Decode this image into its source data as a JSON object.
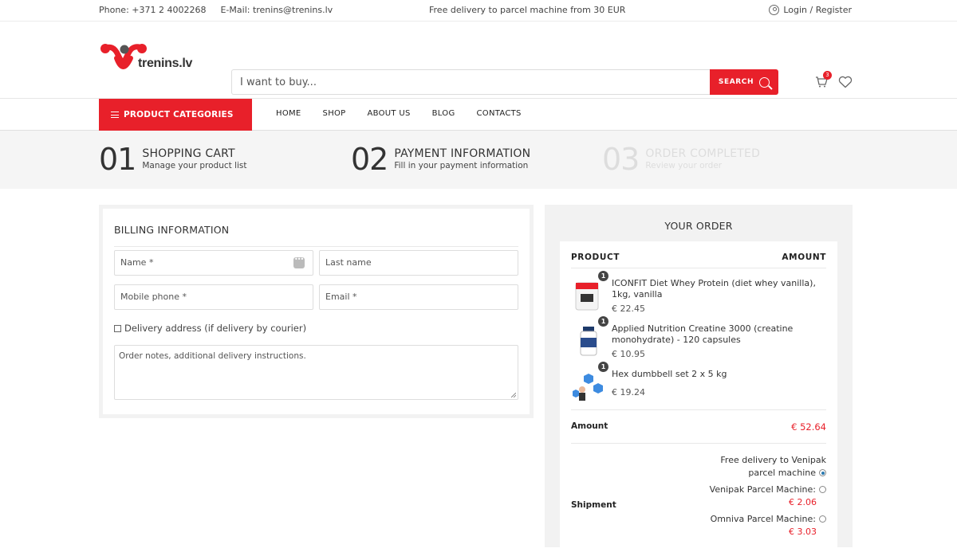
{
  "topbar": {
    "phone": "Phone: +371 2 4002268",
    "email": "E-Mail: trenins@trenins.lv",
    "promo": "Free delivery to parcel machine from 30 EUR",
    "login": "Login / Register"
  },
  "header": {
    "logo_text": "trenins.lv",
    "search_placeholder": "I want to buy...",
    "search_button": "SEARCH",
    "cart_count": "3"
  },
  "nav": {
    "categories_button": "PRODUCT CATEGORIES",
    "links": [
      "HOME",
      "SHOP",
      "ABOUT US",
      "BLOG",
      "CONTACTS"
    ]
  },
  "steps": [
    {
      "num": "01",
      "title": "SHOPPING CART",
      "subtitle": "Manage your product list"
    },
    {
      "num": "02",
      "title": "PAYMENT INFORMATION",
      "subtitle": "Fill in your payment information"
    },
    {
      "num": "03",
      "title": "ORDER COMPLETED",
      "subtitle": "Review your order"
    }
  ],
  "billing": {
    "title": "BILLING INFORMATION",
    "name_placeholder": "Name *",
    "lastname_placeholder": "Last name",
    "phone_placeholder": "Mobile phone *",
    "email_placeholder": "Email *",
    "delivery_checkbox": "Delivery address (if delivery by courier)",
    "notes_placeholder": "Order notes, additional delivery instructions."
  },
  "order": {
    "title": "YOUR ORDER",
    "col_product": "PRODUCT",
    "col_amount": "AMOUNT",
    "items": [
      {
        "qty": "1",
        "name": "ICONFIT Diet Whey Protein (diet whey vanilla), 1kg, vanilla",
        "price": "€ 22.45"
      },
      {
        "qty": "1",
        "name": "Applied Nutrition Creatine 3000 (creatine monohydrate) - 120 capsules",
        "price": "€ 10.95"
      },
      {
        "qty": "1",
        "name": "Hex dumbbell set 2 x 5 kg",
        "price": "€ 19.24"
      }
    ],
    "amount_label": "Amount",
    "amount_value": "€ 52.64",
    "shipment_label": "Shipment",
    "shipping_options": [
      {
        "label": "Free delivery to Venipak parcel machine",
        "price": "",
        "selected": true
      },
      {
        "label": "Venipak Parcel Machine:",
        "price": "€ 2.06",
        "selected": false
      },
      {
        "label": "Omniva Parcel Machine:",
        "price": "€ 3.03",
        "selected": false
      }
    ]
  },
  "colors": {
    "accent": "#e8202a",
    "dark": "#333333",
    "panel": "#f2f2f2"
  }
}
